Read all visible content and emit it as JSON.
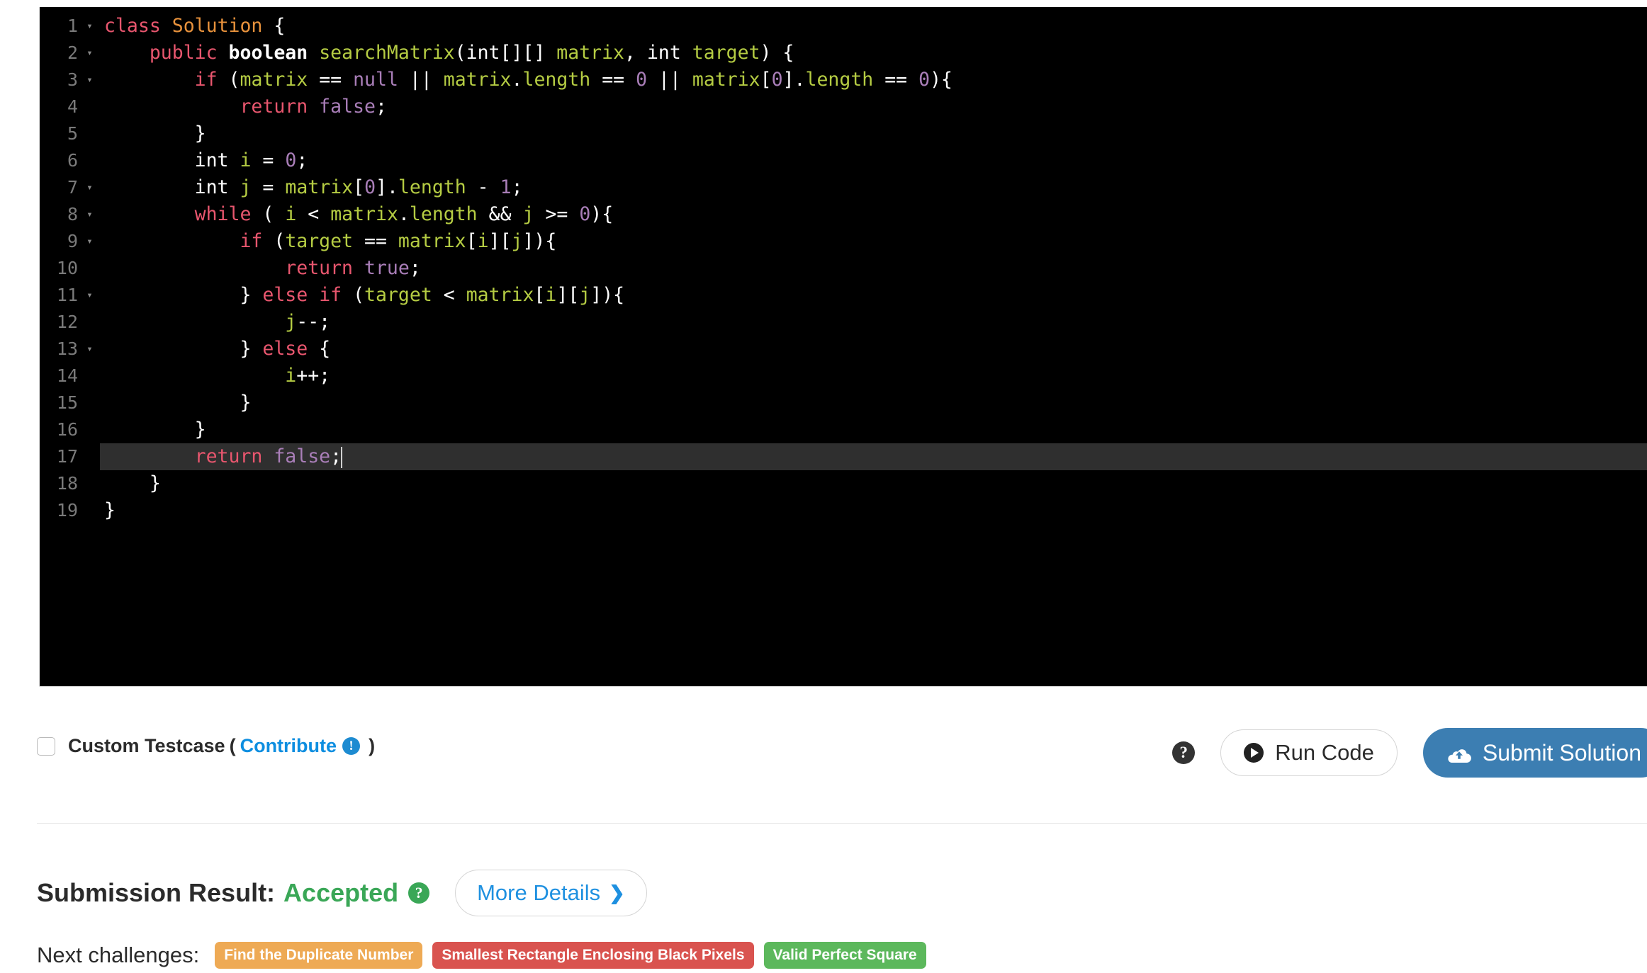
{
  "editor": {
    "language_theme": "dark",
    "active_line": 17,
    "background": "#000000",
    "active_line_background": "#2f2f2f",
    "lines": [
      {
        "n": "1",
        "fold": "▾",
        "indent": 0
      },
      {
        "n": "2",
        "fold": "▾",
        "indent": 1
      },
      {
        "n": "3",
        "fold": "▾",
        "indent": 2
      },
      {
        "n": "4",
        "fold": "",
        "indent": 3
      },
      {
        "n": "5",
        "fold": "",
        "indent": 2
      },
      {
        "n": "6",
        "fold": "",
        "indent": 2
      },
      {
        "n": "7",
        "fold": "▾",
        "indent": 2
      },
      {
        "n": "8",
        "fold": "▾",
        "indent": 2
      },
      {
        "n": "9",
        "fold": "▾",
        "indent": 3
      },
      {
        "n": "10",
        "fold": "",
        "indent": 4
      },
      {
        "n": "11",
        "fold": "▾",
        "indent": 3
      },
      {
        "n": "12",
        "fold": "",
        "indent": 4
      },
      {
        "n": "13",
        "fold": "▾",
        "indent": 3
      },
      {
        "n": "14",
        "fold": "",
        "indent": 4
      },
      {
        "n": "15",
        "fold": "",
        "indent": 3
      },
      {
        "n": "16",
        "fold": "",
        "indent": 2
      },
      {
        "n": "17",
        "fold": "",
        "indent": 2
      },
      {
        "n": "18",
        "fold": "",
        "indent": 1
      },
      {
        "n": "19",
        "fold": "",
        "indent": 0
      }
    ],
    "source_plain": [
      "class Solution {",
      "    public boolean searchMatrix(int[][] matrix, int target) {",
      "        if (matrix == null || matrix.length == 0 || matrix[0].length == 0){",
      "            return false;",
      "        }",
      "        int i = 0;",
      "        int j = matrix[0].length - 1;",
      "        while ( i < matrix.length && j >= 0){",
      "            if (target == matrix[i][j]){",
      "                return true;",
      "            } else if (target < matrix[i][j]){",
      "                j--;",
      "            } else {",
      "                i++;",
      "            }",
      "        }",
      "        return false;",
      "    }",
      "}"
    ],
    "colors": {
      "keyword": "#e8566e",
      "class_name": "#e8923c",
      "function": "#b5cc43",
      "variable": "#b5cc43",
      "number": "#a97eb8",
      "constant": "#a97eb8",
      "punctuation": "#ffffff",
      "line_number": "#7a7a7a"
    }
  },
  "action_bar": {
    "custom_testcase_label": "Custom Testcase",
    "custom_testcase_checked": false,
    "open_paren": "(",
    "close_paren": ")",
    "contribute_label": "Contribute",
    "contribute_info_icon": "info-icon",
    "help_icon": "question-mark-icon",
    "run_code_label": "Run Code",
    "run_code_icon": "play-icon",
    "submit_label": "Submit Solution",
    "submit_icon": "cloud-upload-icon",
    "submit_color": "#3c7eb2"
  },
  "result": {
    "label": "Submission Result:",
    "status": "Accepted",
    "status_color": "#3aa757",
    "help_icon": "question-mark-icon",
    "more_details_label": "More Details",
    "more_details_chevron": "❯"
  },
  "next_challenges": {
    "label": "Next challenges:",
    "items": [
      {
        "label": "Find the Duplicate Number",
        "color": "#eeaa55"
      },
      {
        "label": "Smallest Rectangle Enclosing Black Pixels",
        "color": "#d9534f"
      },
      {
        "label": "Valid Perfect Square",
        "color": "#5cb85c"
      }
    ]
  }
}
